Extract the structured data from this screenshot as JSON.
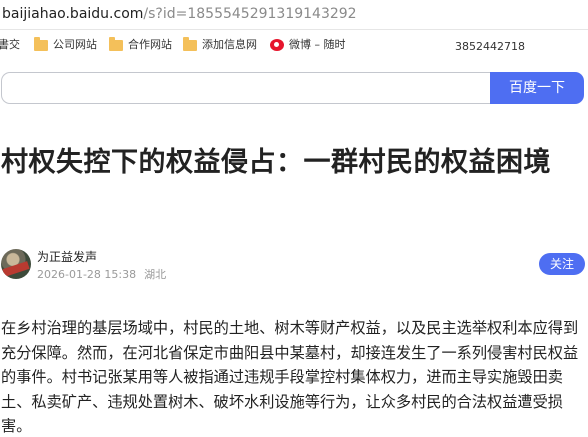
{
  "address_bar": {
    "host": "baijiahao.baidu.com",
    "path": "/s?id=1855545291319143292"
  },
  "bookmarks": [
    {
      "label": "書交",
      "icon": "none"
    },
    {
      "label": "公司网站",
      "icon": "folder-icon"
    },
    {
      "label": "合作网站",
      "icon": "folder-icon"
    },
    {
      "label": "添加信息网",
      "icon": "folder-icon"
    },
    {
      "label": "微博 – 随时",
      "icon": "weibo-icon"
    }
  ],
  "phone_number": "3852442718",
  "search": {
    "value": "",
    "button_label": "百度一下"
  },
  "article": {
    "title": "村权失控下的权益侵占：一群村民的权益困境",
    "author": "为正益发声",
    "date": "2026-01-28 15:38",
    "location": "湖北",
    "follow_label": "关注",
    "body": "在乡村治理的基层场域中，村民的土地、树木等财产权益，以及民主选举权利本应得到充分保障。然而，在河北省保定市曲阳县中某墓村，却接连发生了一系列侵害村民权益的事件。村书记张某用等人被指通过违规手段掌控村集体权力，进而主导实施毁田卖土、私卖矿产、违规处置树木、破坏水利设施等行为，让众多村民的合法权益遭受损害。"
  },
  "colors": {
    "accent": "#4e6ef2",
    "folder": "#f4c05a",
    "weibo": "#e6162d"
  }
}
